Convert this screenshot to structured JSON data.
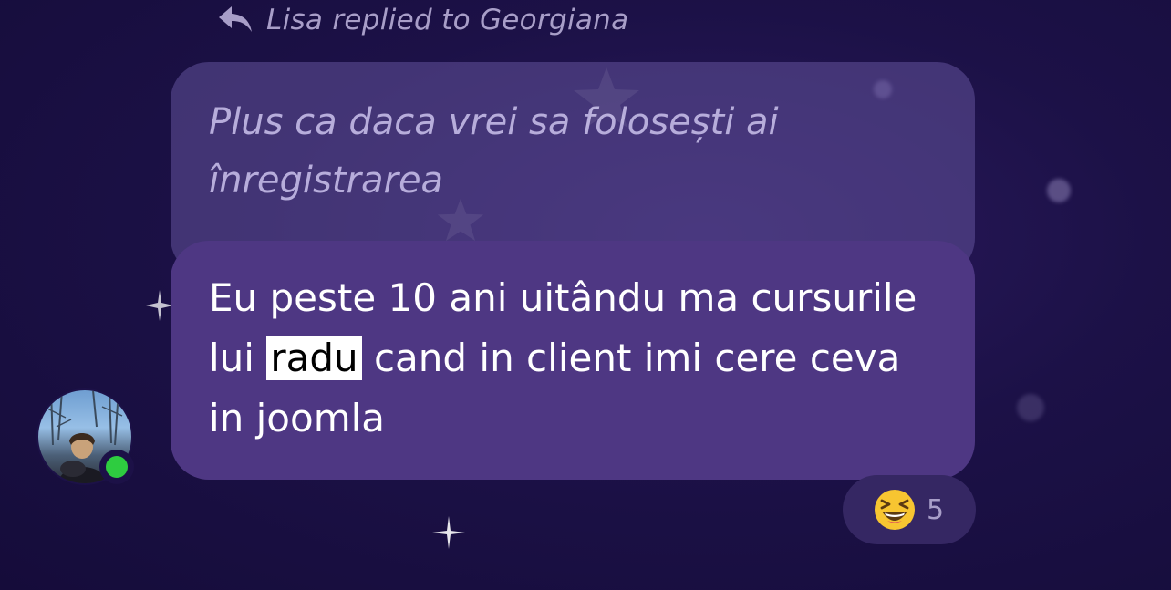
{
  "reply_header": {
    "text": "Lisa replied to Georgiana",
    "icon": "reply-arrow-icon"
  },
  "quoted_message": {
    "text": "Plus ca daca vrei sa folosești ai înregistrarea"
  },
  "message": {
    "before_highlight": "Eu peste 10 ani uitându ma cursurile lui ",
    "highlight": "radu",
    "after_highlight": " cand in client imi cere ceva in joomla"
  },
  "sender": {
    "avatar": "user-avatar",
    "online_status": "online",
    "status_color": "#2ecc40"
  },
  "reaction": {
    "emoji": "laughing-face",
    "count": "5"
  },
  "colors": {
    "background": "#1c1147",
    "bubble": "#4e3783",
    "quoted_bubble": "#5a4a8f",
    "muted_text": "#a89ec8"
  }
}
